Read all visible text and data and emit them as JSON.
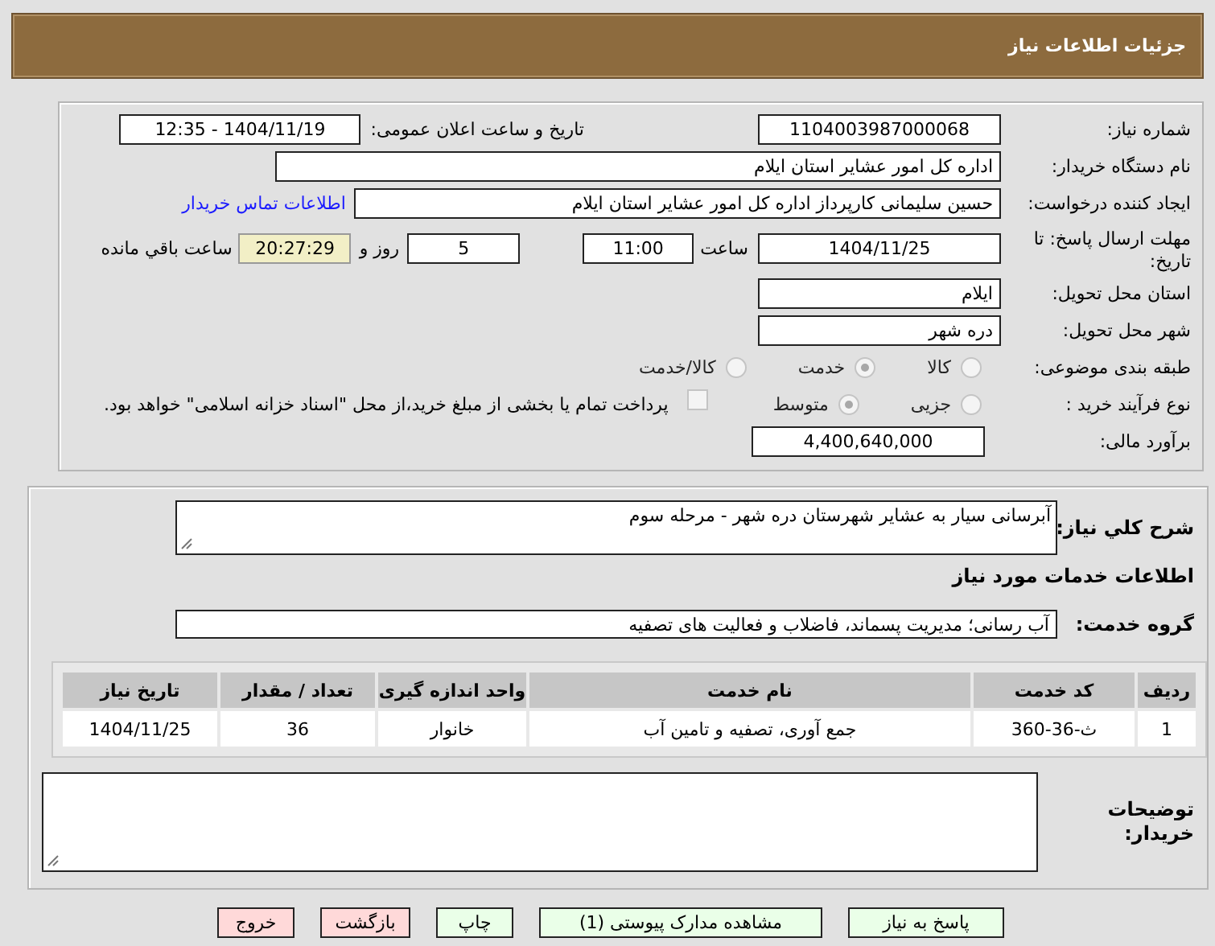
{
  "header": {
    "title": "جزئیات اطلاعات نیاز"
  },
  "details": {
    "need_number": {
      "label": "شماره نیاز:",
      "value": "1104003987000068"
    },
    "announce": {
      "label": "تاریخ و ساعت اعلان عمومی:",
      "value": "1404/11/19 - 12:35"
    },
    "buyer_org": {
      "label": "نام دستگاه خریدار:",
      "value": "اداره کل امور عشایر استان ایلام"
    },
    "requester": {
      "label": "ایجاد کننده درخواست:",
      "value": "حسین سلیمانی کارپرداز اداره کل امور عشایر استان ایلام",
      "link": "اطلاعات تماس خریدار"
    },
    "deadline": {
      "label": "مهلت ارسال پاسخ: تا تاریخ:",
      "date": "1404/11/25",
      "time_label": "ساعت",
      "time": "11:00",
      "days": "5",
      "days_label": "روز و",
      "remaining": "20:27:29",
      "remaining_label": "ساعت باقي مانده"
    },
    "province": {
      "label": "استان محل تحویل:",
      "value": "ایلام"
    },
    "city": {
      "label": "شهر محل تحویل:",
      "value": "دره شهر"
    },
    "category": {
      "label": "طبقه بندی موضوعی:",
      "options": [
        {
          "label": "کالا",
          "selected": false
        },
        {
          "label": "خدمت",
          "selected": true
        },
        {
          "label": "کالا/خدمت",
          "selected": false
        }
      ]
    },
    "process": {
      "label": "نوع فرآیند خرید :",
      "options": [
        {
          "label": "جزیی",
          "selected": false
        },
        {
          "label": "متوسط",
          "selected": true
        }
      ],
      "payment": {
        "label": "پرداخت تمام یا بخشی از مبلغ خرید،از محل \"اسناد خزانه اسلامی\" خواهد بود.",
        "checked": false
      }
    },
    "budget": {
      "label": "برآورد مالی:",
      "value": "4,400,640,000"
    }
  },
  "services": {
    "description": {
      "label": "شرح کلي نیاز:",
      "value": "آبرسانی سیار به عشایر شهرستان دره شهر - مرحله سوم"
    },
    "heading": "اطلاعات خدمات مورد نیاز",
    "service_group": {
      "label": "گروه خدمت:",
      "value": "آب رسانی؛ مدیریت پسماند، فاضلاب و فعالیت های تصفیه"
    },
    "table": {
      "columns": [
        "ردیف",
        "کد خدمت",
        "نام خدمت",
        "واحد اندازه گیری",
        "تعداد / مقدار",
        "تاریخ نیاز"
      ],
      "rows": [
        [
          "1",
          "ث-36-360",
          "جمع آوری، تصفیه و تامین آب",
          "خانوار",
          "36",
          "1404/11/25"
        ]
      ]
    },
    "buyer_notes": {
      "label": "توضیحات خریدار:"
    }
  },
  "buttons": [
    {
      "label": "پاسخ به نیاز",
      "kind": "normal"
    },
    {
      "label": "مشاهده مدارک پیوستی (1)",
      "kind": "normal"
    },
    {
      "label": "چاپ",
      "kind": "normal"
    },
    {
      "label": "بازگشت",
      "kind": "exit"
    },
    {
      "label": "خروج",
      "kind": "exit"
    }
  ]
}
